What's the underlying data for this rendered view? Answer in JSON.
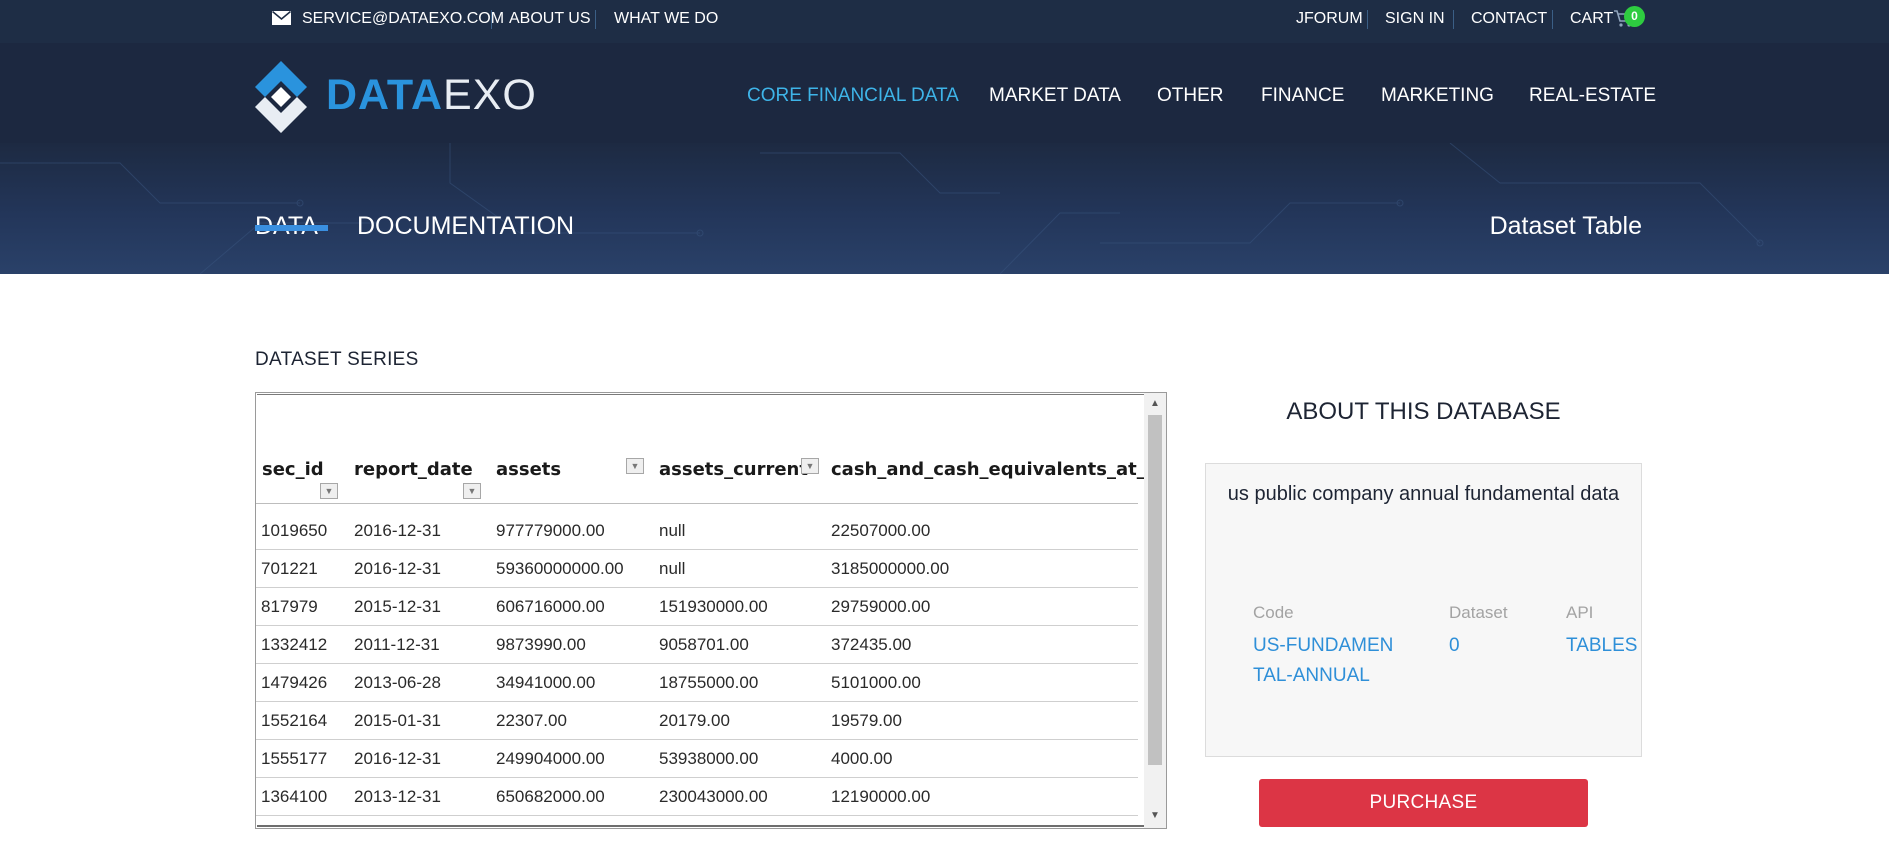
{
  "topbar": {
    "email": "SERVICE@DATAEXO.COM",
    "about": "ABOUT US",
    "what_we_do": "WHAT WE DO",
    "jforum": "JFORUM",
    "sign_in": "SIGN IN",
    "contact": "CONTACT",
    "cart": "CART",
    "cart_count": "0"
  },
  "logo": {
    "bold": "DATA",
    "thin": "EXO"
  },
  "nav": [
    "CORE FINANCIAL DATA",
    "MARKET DATA",
    "OTHER",
    "FINANCE",
    "MARKETING",
    "REAL-ESTATE"
  ],
  "tabs": {
    "data": "DATA",
    "documentation": "DOCUMENTATION"
  },
  "page_subtitle": "Dataset Table",
  "section_title": "DATASET SERIES",
  "table": {
    "columns": [
      "sec_id",
      "report_date",
      "assets",
      "assets_current",
      "cash_and_cash_equivalents_at_"
    ],
    "rows": [
      [
        "1019650",
        "2016-12-31",
        "977779000.00",
        "null",
        "22507000.00"
      ],
      [
        "701221",
        "2016-12-31",
        "59360000000.00",
        "null",
        "3185000000.00"
      ],
      [
        "817979",
        "2015-12-31",
        "606716000.00",
        "151930000.00",
        "29759000.00"
      ],
      [
        "1332412",
        "2011-12-31",
        "9873990.00",
        "9058701.00",
        "372435.00"
      ],
      [
        "1479426",
        "2013-06-28",
        "34941000.00",
        "18755000.00",
        "5101000.00"
      ],
      [
        "1552164",
        "2015-01-31",
        "22307.00",
        "20179.00",
        "19579.00"
      ],
      [
        "1555177",
        "2016-12-31",
        "249904000.00",
        "53938000.00",
        "4000.00"
      ],
      [
        "1364100",
        "2013-12-31",
        "650682000.00",
        "230043000.00",
        "12190000.00"
      ]
    ]
  },
  "about": {
    "title": "ABOUT THIS DATABASE",
    "name": "us public company annual fundamental data",
    "code_label": "Code",
    "code_value": "US-FUNDAMENTAL-ANNUAL",
    "dataset_label": "Dataset",
    "dataset_value": "0",
    "api_label": "API",
    "api_value": "TABLES"
  },
  "purchase_label": "PURCHASE",
  "colors": {
    "topbar": "#1e2d45",
    "hero": "#1c2840",
    "accent_blue": "#3eb4e8",
    "link_blue": "#2e8fd8",
    "purchase_red": "#dc3545",
    "badge_green": "#2ecc40"
  }
}
